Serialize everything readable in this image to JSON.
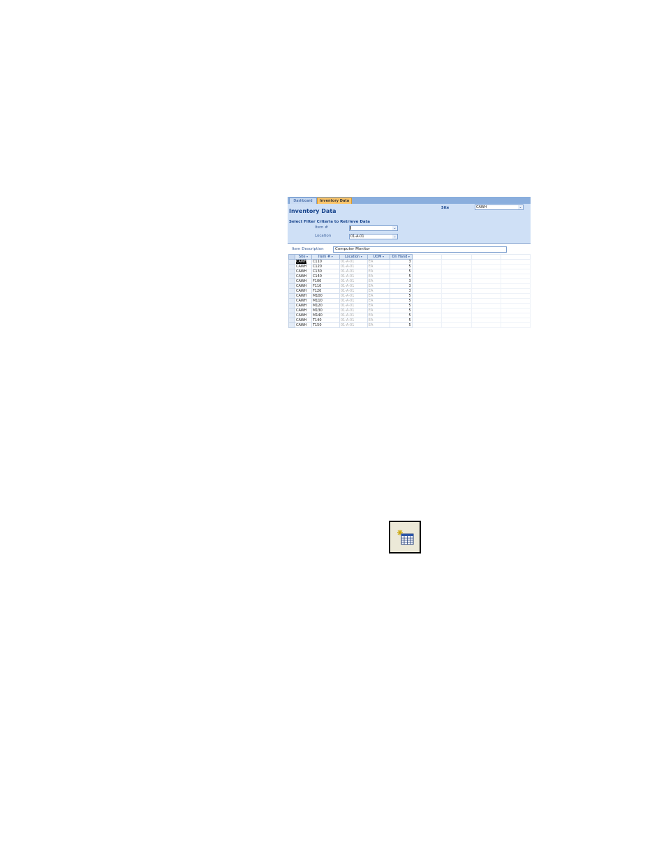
{
  "tabs": [
    {
      "label": "Dashboard",
      "active": false
    },
    {
      "label": "Inventory Data",
      "active": true
    }
  ],
  "header": {
    "title": "Inventory Data",
    "site_label": "Site",
    "site_value": "CAWH",
    "filter_heading": "Select Filter Criteria to Retrieve Data",
    "item_label": "Item #",
    "item_value": "",
    "location_label": "Location",
    "location_value": "01-A-01"
  },
  "item_description": {
    "label": "Item Description",
    "value": "Computer Monitor"
  },
  "grid": {
    "columns": [
      "Site",
      "Item #",
      "Location",
      "UOM",
      "On Hand"
    ],
    "rows": [
      [
        "CAWH",
        "C110",
        "01-A-01",
        "EA",
        "3"
      ],
      [
        "CAWH",
        "C120",
        "01-A-01",
        "EA",
        "5"
      ],
      [
        "CAWH",
        "C130",
        "01-A-01",
        "EA",
        "5"
      ],
      [
        "CAWH",
        "C140",
        "01-A-01",
        "EA",
        "5"
      ],
      [
        "CAWH",
        "F100",
        "01-A-01",
        "EA",
        "3"
      ],
      [
        "CAWH",
        "F110",
        "01-A-01",
        "EA",
        "3"
      ],
      [
        "CAWH",
        "F120",
        "01-A-01",
        "EA",
        "3"
      ],
      [
        "CAWH",
        "M100",
        "01-A-01",
        "EA",
        "5"
      ],
      [
        "CAWH",
        "M110",
        "01-A-01",
        "EA",
        "5"
      ],
      [
        "CAWH",
        "M120",
        "01-A-01",
        "EA",
        "5"
      ],
      [
        "CAWH",
        "M130",
        "01-A-01",
        "EA",
        "5"
      ],
      [
        "CAWH",
        "M140",
        "01-A-01",
        "EA",
        "5"
      ],
      [
        "CAWH",
        "T140",
        "01-A-01",
        "EA",
        "5"
      ],
      [
        "CAWH",
        "T150",
        "01-A-01",
        "EA",
        "5"
      ]
    ]
  },
  "toolbar_icon": {
    "name": "new-datasheet-icon"
  },
  "colors": {
    "header_bg": "#cfe0f6",
    "tabbar_bg": "#8aaedd",
    "active_tab": "#fbc56a",
    "label_blue": "#15428b"
  }
}
